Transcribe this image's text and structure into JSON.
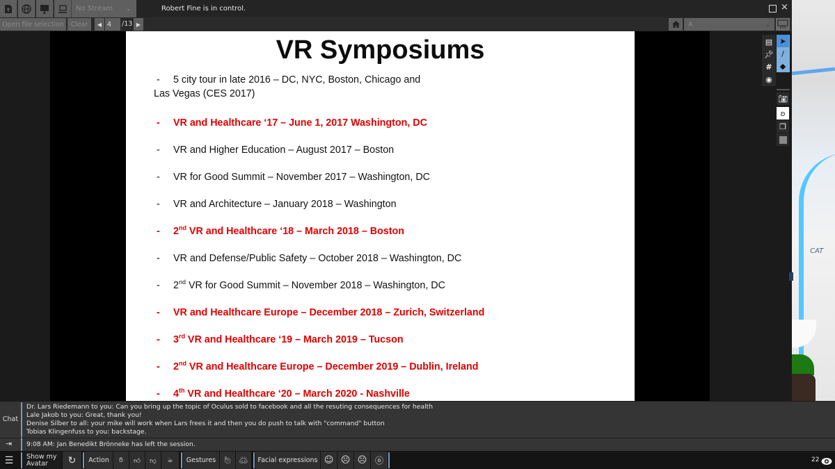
{
  "topbar": {
    "icons": [
      "upload-file-icon",
      "globe-icon",
      "screen-share-icon",
      "laptop-icon"
    ],
    "stream_select": "No Stream",
    "control_status": "Robert Fine is in control."
  },
  "presentation_bar": {
    "open_file": "Open file selection",
    "clear": "Clear",
    "page_current": "4",
    "page_total": "/13",
    "font_select": "A"
  },
  "slide": {
    "title": "VR Symposiums",
    "items": [
      {
        "sup_prefix": "",
        "lines": [
          "5 city tour in late 2016 – DC, NYC, Boston, Chicago and",
          "Las Vegas (CES 2017)"
        ],
        "highlight": false
      },
      {
        "num": "",
        "sup": "",
        "text": "VR and Healthcare ‘17 – June 1, 2017 Washington, DC",
        "highlight": true
      },
      {
        "num": "",
        "sup": "",
        "text": "VR and Higher Education – August 2017 – Boston",
        "highlight": false
      },
      {
        "num": "",
        "sup": "",
        "text": "VR for Good Summit – November 2017 – Washington, DC",
        "highlight": false
      },
      {
        "num": "",
        "sup": "",
        "text": "VR and Architecture – January 2018 – Washington",
        "highlight": false
      },
      {
        "num": "2",
        "sup": "nd",
        "text": " VR and Healthcare ‘18 – March 2018 – Boston",
        "highlight": true
      },
      {
        "num": "",
        "sup": "",
        "text": "VR and Defense/Public Safety – October 2018 – Washington, DC",
        "highlight": false
      },
      {
        "num": "2",
        "sup": "nd",
        "text": " VR for Good Summit – November 2018 – Washington, DC",
        "highlight": false
      },
      {
        "num": "",
        "sup": "",
        "text": "VR and Healthcare Europe – December 2018 – Zurich, Switzerland",
        "highlight": true
      },
      {
        "num": "3",
        "sup": "rd",
        "text": " VR and Healthcare ‘19 – March 2019 – Tucson",
        "highlight": true
      },
      {
        "num": "2",
        "sup": "nd",
        "text": " VR and Healthcare Europe – December 2019 – Dublin, Ireland",
        "highlight": true
      },
      {
        "num": "4",
        "sup": "th",
        "text": " VR and Healthcare ‘20 – March 2020 - Nashville",
        "highlight": true
      }
    ],
    "bullet": "-"
  },
  "tools": {
    "left_column": [
      "document-icon",
      "pin-icon",
      "grid-icon",
      "webcam-icon"
    ],
    "right_column": [
      "pointer-icon",
      "pen-icon",
      "eraser-icon",
      "camera-icon",
      "lasso-icon",
      "layers-icon",
      "color-swatch-icon"
    ]
  },
  "scene_text": "CAT",
  "chat": {
    "label": "Chat",
    "messages": [
      "Dr. Lars Riedemann to you: Can you bring up the topic of Oculus sold to facebook and all the resuting consequences for health",
      "Lale Jakob to you: Great, thank you!",
      "Denise Silber to all: your mike will work when Lars frees it and then you do push to talk with \"command\" button",
      "Tobias Klingenfuss to you: backstage."
    ],
    "notice": "9:08 AM: Jan Benedikt Brönneke has left the session."
  },
  "bottombar": {
    "show_avatar": "Show my Avatar",
    "action": "Action",
    "gestures": "Gestures",
    "facial": "Facial expressions",
    "viewer_count": "22"
  },
  "colors": {
    "highlight_red": "#e00000",
    "accent_blue": "#7a99b8",
    "tool_active": "#4a90d9"
  }
}
